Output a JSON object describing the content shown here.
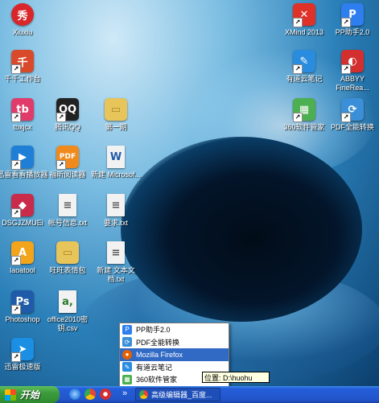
{
  "desktop_icons": [
    {
      "label": "Xiuxiu",
      "glyph": "秀",
      "color": "#d8262b",
      "icon": "meitu-xiuxiu-icon"
    },
    {
      "label": "千千工作台",
      "glyph": "千",
      "color": "#d94a2a",
      "icon": "qianqian-workbench-icon"
    },
    {
      "label": "tbxjcx",
      "glyph": "tb",
      "color": "#e03b6a",
      "icon": "tbxjcx-icon"
    },
    {
      "label": "腾讯QQ",
      "glyph": "QQ",
      "color": "#222222",
      "icon": "qq-penguin-icon"
    },
    {
      "label": "第一期",
      "glyph": "▭",
      "color": "#e8c55a",
      "icon": "folder-icon"
    },
    {
      "label": "迅雷看看播放器",
      "glyph": "▶",
      "color": "#1f7fd6",
      "icon": "xunlei-kankan-icon"
    },
    {
      "label": "福昕阅读器",
      "glyph": "PDF",
      "color": "#f08a1d",
      "icon": "foxit-reader-icon"
    },
    {
      "label": "新建 Microsof...",
      "glyph": "W",
      "color": "#f2f2f2",
      "icon": "word-document-icon"
    },
    {
      "label": "DSGJZMUEi",
      "glyph": "◆",
      "color": "#c92b4a",
      "icon": "dsg-app-icon"
    },
    {
      "label": "帐号信息.txt",
      "glyph": "≡",
      "color": "#f2f2f2",
      "icon": "text-file-icon"
    },
    {
      "label": "要求.txt",
      "glyph": "≡",
      "color": "#f2f2f2",
      "icon": "text-file-icon"
    },
    {
      "label": "laoatool",
      "glyph": "A",
      "color": "#f2a51b",
      "icon": "laoatool-icon"
    },
    {
      "label": "旺旺表情包",
      "glyph": "▭",
      "color": "#e8c55a",
      "icon": "folder-icon"
    },
    {
      "label": "新建 文本文档.txt",
      "glyph": "≡",
      "color": "#f2f2f2",
      "icon": "text-file-icon"
    },
    {
      "label": "Photoshop",
      "glyph": "Ps",
      "color": "#1f5ba8",
      "icon": "photoshop-icon"
    },
    {
      "label": "office2010密钥.csv",
      "glyph": "a,",
      "color": "#f2f2f2",
      "icon": "csv-file-icon"
    },
    {
      "label": "迅雷极速版",
      "glyph": "➤",
      "color": "#1a8fe3",
      "icon": "xunlei-speed-icon"
    },
    {
      "label": "XMind 2013",
      "glyph": "✕",
      "color": "#e03128",
      "icon": "xmind-icon"
    },
    {
      "label": "PP助手2.0",
      "glyph": "P",
      "color": "#2e7ef0",
      "icon": "pp-assistant-icon"
    },
    {
      "label": "有道云笔记",
      "glyph": "✎",
      "color": "#2a8cdf",
      "icon": "youdao-note-icon"
    },
    {
      "label": "ABBYY FineRea...",
      "glyph": "◐",
      "color": "#d32f2f",
      "icon": "abbyy-finereader-icon"
    },
    {
      "label": "360软件管家",
      "glyph": "▦",
      "color": "#4caf50",
      "icon": "360-software-manager-icon"
    },
    {
      "label": "PDF全能转换",
      "glyph": "⟳",
      "color": "#3b8fd8",
      "icon": "pdf-converter-icon"
    }
  ],
  "popup_menu": {
    "items": [
      {
        "label": "PP助手2.0",
        "color": "#2e7ef0",
        "glyph": "P"
      },
      {
        "label": "PDF全能转换",
        "color": "#3b8fd8",
        "glyph": "⟳"
      },
      {
        "label": "Mozilla Firefox",
        "color": "#e66000",
        "glyph": "●"
      },
      {
        "label": "有道云笔记",
        "color": "#2a8cdf",
        "glyph": "✎"
      },
      {
        "label": "360软件管家",
        "color": "#4caf50",
        "glyph": "▦"
      }
    ],
    "selected_index": 2
  },
  "tooltip": {
    "text": "位置: D:\\huohu"
  },
  "taskbar": {
    "start_label": "开始",
    "quick_launch": [
      {
        "icon": "ie-browser-icon",
        "color": "#2b7de0"
      },
      {
        "icon": "chrome-icon",
        "color": "#e04a3a"
      },
      {
        "icon": "abbyy-icon",
        "color": "#d32f2f"
      }
    ],
    "overflow_glyph": "»",
    "task_button_label": "高级编辑器_百度..."
  }
}
